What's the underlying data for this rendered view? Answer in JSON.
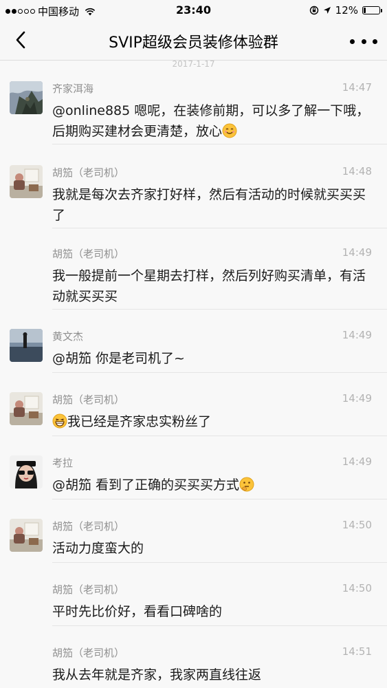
{
  "status_bar": {
    "carrier": "中国移动",
    "time": "23:40",
    "battery_percent": "12%",
    "battery_level": 0.12,
    "signal_dots_filled": 2,
    "signal_dots_total": 5
  },
  "nav": {
    "title": "SVIP超级会员装修体验群"
  },
  "date_separator": "2017-1-17",
  "messages": [
    {
      "sender": "齐家洱海",
      "time": "14:47",
      "text": "@online885 嗯呢，在装修前期，可以多了解一下哦，后期购买建材会更清楚，放心",
      "emoji_after": "smile-emoji",
      "avatar": "rock-avatar"
    },
    {
      "sender": "胡笳（老司机）",
      "time": "14:48",
      "text": "我就是每次去齐家打好样，然后有活动的时候就买买买了",
      "avatar": "room-avatar"
    },
    {
      "sender": "胡笳（老司机）",
      "time": "14:49",
      "text": "我一般提前一个星期去打样，然后列好购买清单，有活动就买买买"
    },
    {
      "sender": "黄文杰",
      "time": "14:49",
      "text": "@胡笳 你是老司机了~",
      "avatar": "beach-avatar"
    },
    {
      "sender": "胡笳（老司机）",
      "time": "14:49",
      "text": "我已经是齐家忠实粉丝了",
      "emoji_before": "grin-emoji",
      "avatar": "room-avatar"
    },
    {
      "sender": "考拉",
      "time": "14:49",
      "text": "@胡笳 看到了正确的买买买方式",
      "emoji_after": "thinking-emoji",
      "avatar": "sunglasses-avatar"
    },
    {
      "sender": "胡笳（老司机）",
      "time": "14:50",
      "text": "活动力度蛮大的",
      "avatar": "room-avatar"
    },
    {
      "sender": "胡笳（老司机）",
      "time": "14:50",
      "text": "平时先比价好，看看口碑啥的"
    },
    {
      "sender": "胡笳（老司机）",
      "time": "14:51",
      "text": "我从去年就是齐家，我家两直线往返"
    }
  ],
  "colors": {
    "background": "#f8f8f8",
    "sender_name": "#8f8f8f",
    "timestamp": "#b3b3b3",
    "message_text": "#1a1a1a"
  }
}
